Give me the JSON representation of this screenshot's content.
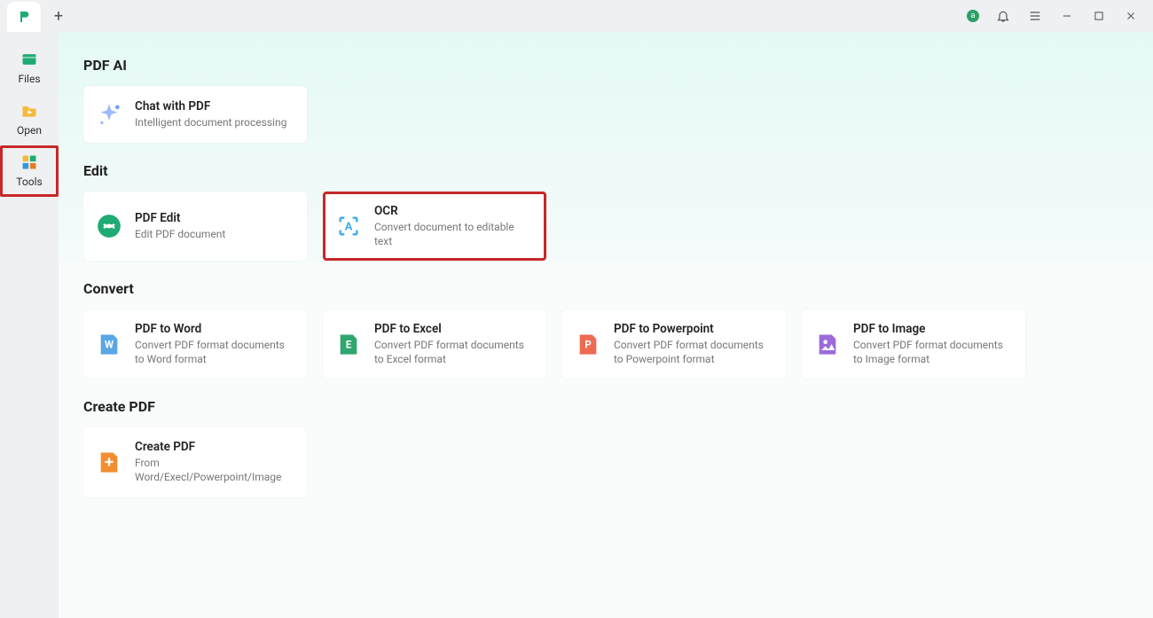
{
  "titlebar": {
    "avatar_initial": "a"
  },
  "sidebar": {
    "items": [
      {
        "label": "Files"
      },
      {
        "label": "Open"
      },
      {
        "label": "Tools",
        "selected": true
      }
    ]
  },
  "sections": {
    "pdf_ai": {
      "title": "PDF AI",
      "cards": [
        {
          "title": "Chat with PDF",
          "desc": "Intelligent document processing"
        }
      ]
    },
    "edit": {
      "title": "Edit",
      "cards": [
        {
          "title": "PDF Edit",
          "desc": "Edit PDF document"
        },
        {
          "title": "OCR",
          "desc": "Convert document to editable text",
          "highlight": true
        }
      ]
    },
    "convert": {
      "title": "Convert",
      "cards": [
        {
          "title": "PDF to Word",
          "desc": "Convert PDF format documents to Word format"
        },
        {
          "title": "PDF to Excel",
          "desc": "Convert PDF format documents to Excel format"
        },
        {
          "title": "PDF to Powerpoint",
          "desc": "Convert PDF format documents to Powerpoint format"
        },
        {
          "title": "PDF to Image",
          "desc": "Convert PDF format documents to Image format"
        }
      ]
    },
    "create_pdf": {
      "title": "Create PDF",
      "cards": [
        {
          "title": "Create PDF",
          "desc": "From Word/Execl/Powerpoint/Image"
        }
      ]
    }
  }
}
